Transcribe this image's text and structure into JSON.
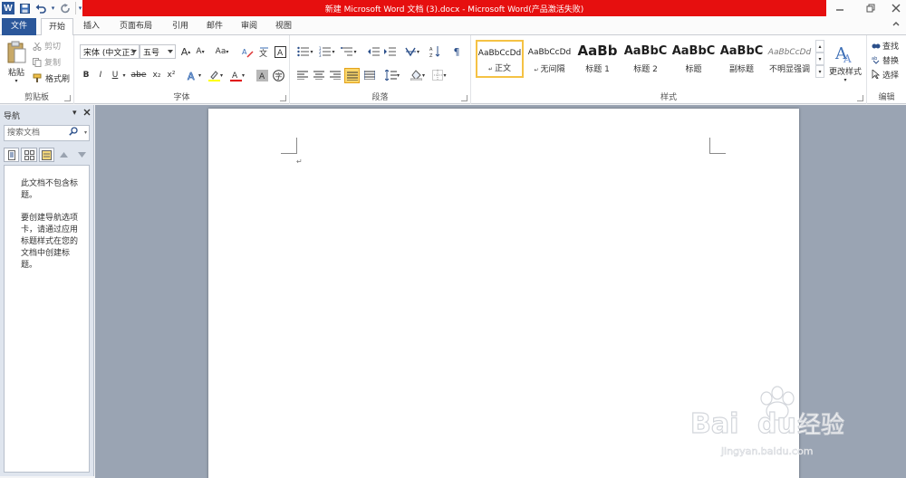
{
  "window": {
    "title": "新建 Microsoft Word 文档 (3).docx  -  Microsoft Word(产品激活失败)",
    "title_bar_color": "#e60f0f",
    "accent": "#2b579a"
  },
  "quick_access": {
    "app_icon": "W",
    "items": [
      "save-icon",
      "undo-icon",
      "redo-icon",
      "customize-icon"
    ]
  },
  "tabs": [
    {
      "label": "文件"
    },
    {
      "label": "开始"
    },
    {
      "label": "插入"
    },
    {
      "label": "页面布局"
    },
    {
      "label": "引用"
    },
    {
      "label": "邮件"
    },
    {
      "label": "审阅"
    },
    {
      "label": "视图"
    }
  ],
  "active_tab": "开始",
  "ribbon": {
    "clipboard": {
      "label": "剪贴板",
      "paste": "粘贴",
      "cut": "剪切",
      "copy": "复制",
      "format_painter": "格式刷"
    },
    "font": {
      "label": "字体",
      "font_name": "宋体 (中文正3",
      "font_size": "五号",
      "btn_grow": "A",
      "btn_shrink": "A",
      "btn_case": "Aa",
      "btn_bold": "B",
      "btn_italic": "I",
      "btn_underline": "U",
      "btn_strike": "abe",
      "btn_sub": "x₂",
      "btn_sup": "x²"
    },
    "paragraph": {
      "label": "段落"
    },
    "styles": {
      "label": "样式",
      "items": [
        {
          "preview": "AaBbCcDd",
          "name": "正文",
          "selected": true
        },
        {
          "preview": "AaBbCcDd",
          "name": "无间隔"
        },
        {
          "preview": "AaBb",
          "name": "标题 1"
        },
        {
          "preview": "AaBbC",
          "name": "标题 2"
        },
        {
          "preview": "AaBbC",
          "name": "标题"
        },
        {
          "preview": "AaBbC",
          "name": "副标题"
        },
        {
          "preview": "AaBbCcDd",
          "name": "不明显强调"
        }
      ],
      "change_styles": "更改样式"
    },
    "editing": {
      "label": "编辑",
      "find": "查找",
      "replace": "替换",
      "select": "选择"
    }
  },
  "navigation": {
    "title": "导航",
    "search_placeholder": "搜索文档",
    "message1": "此文档不包含标题。",
    "message2": "要创建导航选项卡，请通过应用标题样式在您的文档中创建标题。"
  },
  "document": {
    "paragraph_mark": "↵"
  },
  "watermark": {
    "brand": "Baidu",
    "cn": "经验",
    "url": "jingyan.baidu.com"
  }
}
